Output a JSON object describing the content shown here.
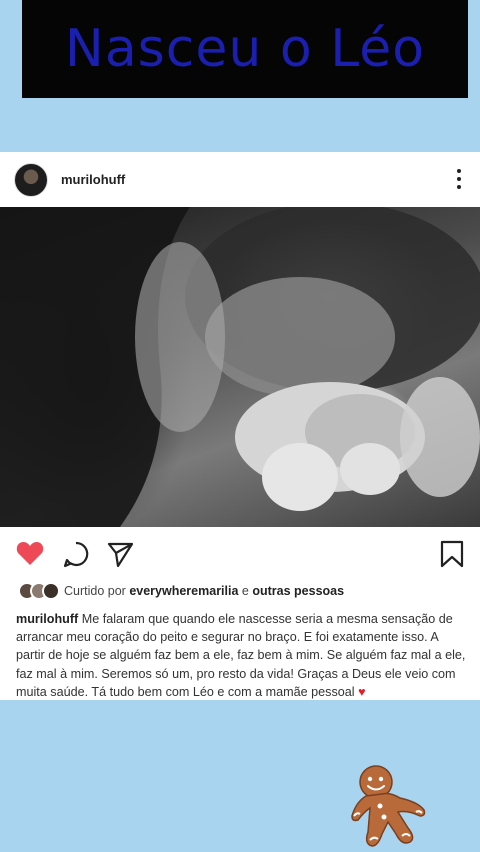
{
  "banner": {
    "title": "Nasceu o Léo"
  },
  "post": {
    "username": "murilohuff",
    "likes": {
      "prefix": "Curtido por",
      "user": "everywheremarilia",
      "joiner": "e",
      "others": "outras pessoas"
    },
    "caption": {
      "username": "murilohuff",
      "text": "Me falaram que quando ele nascesse seria a mesma sensação de arrancar meu coração do peito e segurar no braço. E foi exatamente isso. A partir de hoje se alguém faz bem a ele, faz bem à mim. Se alguém faz mal a ele, faz mal à mim. Seremos só um, pro resto da vida! Graças a Deus ele veio com muita saúde. Tá tudo bem com Léo e com a mamãe pessoal",
      "emoji": "♥"
    }
  },
  "icons": {
    "like": "heart-icon-filled",
    "comment": "comment-icon",
    "share": "send-icon",
    "save": "bookmark-icon",
    "more": "more-options-icon",
    "sticker": "gingerbread-man-sticker"
  },
  "colors": {
    "background": "#a9d4ef",
    "banner_bg": "#050505",
    "banner_text": "#1a1fb0",
    "like_red": "#ed4956"
  }
}
